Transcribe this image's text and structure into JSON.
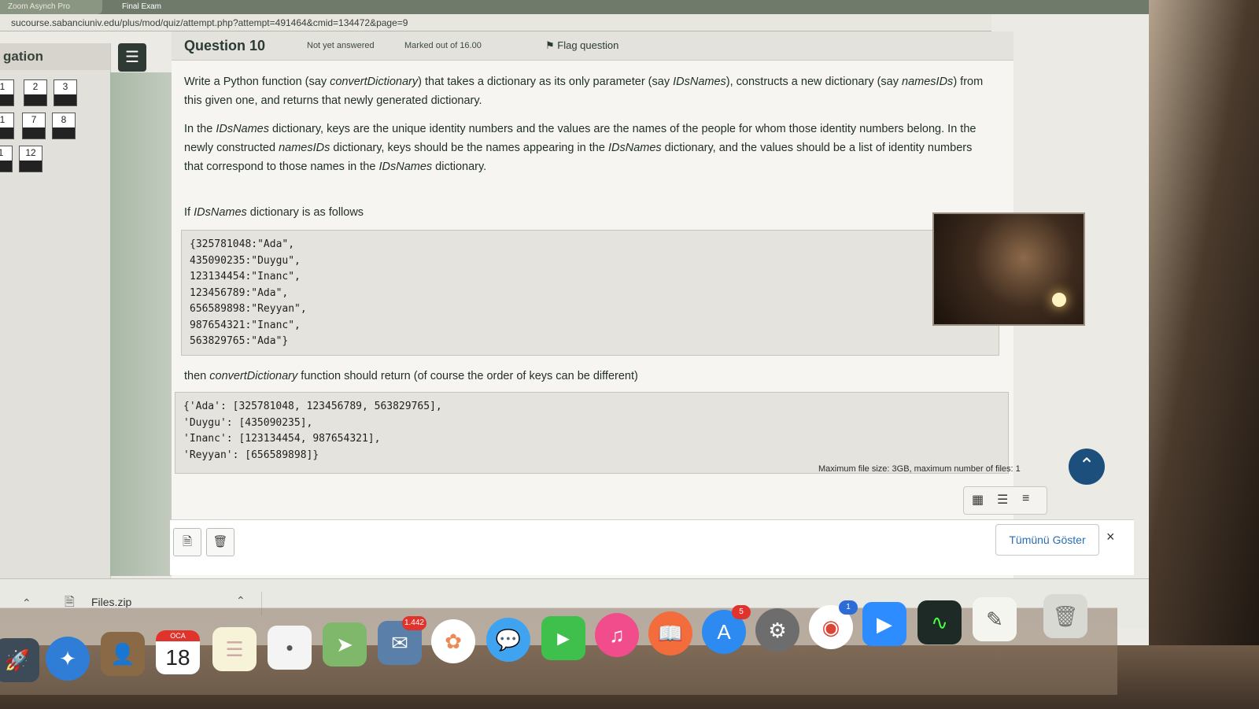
{
  "browser": {
    "tab_active": "Zoom Asynch Pro",
    "tab_second": "Final Exam",
    "url": "sucourse.sabanciuniv.edu/plus/mod/quiz/attempt.php?attempt=491464&cmid=134472&page=9"
  },
  "navigation": {
    "title": "gation",
    "boxes": [
      "1",
      "2",
      "3",
      "1",
      "7",
      "8",
      "1",
      "12"
    ]
  },
  "question": {
    "title": "Question 10",
    "state": "Not yet answered",
    "marked": "Marked out of 16.00",
    "flag": "Flag question",
    "para1_a": "Write a Python function (say ",
    "para1_fn": "convertDictionary",
    "para1_b": ") that takes a dictionary as its only parameter (say ",
    "para1_p": "IDsNames",
    "para1_c": "), constructs a new dictionary (say ",
    "para1_n": "namesIDs",
    "para1_d": ") from this given one, and returns that newly generated dictionary.",
    "para2_a": "In the ",
    "para2_i": "IDsNames",
    "para2_b": " dictionary, keys are the unique identity numbers and the values are the names of the people for whom those identity numbers belong. In the newly constructed ",
    "para2_n": "namesIDs",
    "para2_c": " dictionary, keys should be the names appearing in the ",
    "para2_i2": "IDsNames",
    "para2_d": " dictionary, and the values should be a list of identity numbers that correspond to those names in the ",
    "para2_i3": "IDsNames",
    "para2_e": " dictionary.",
    "para3_a": "If ",
    "para3_i": "IDsNames",
    "para3_b": " dictionary is as follows",
    "code1": [
      "{325781048:\"Ada\",",
      "435090235:\"Duygu\",",
      "123134454:\"Inanc\",",
      "123456789:\"Ada\",",
      "656589898:\"Reyyan\",",
      "987654321:\"Inanc\",",
      "563829765:\"Ada\"}"
    ],
    "para4_a": "then ",
    "para4_i": "convertDictionary",
    "para4_b": " function should return (of course the order of keys can be different)",
    "code2": [
      "{'Ada': [325781048, 123456789, 563829765],",
      "'Duygu': [435090235],",
      "'Inanc': [123134454, 987654321],",
      "'Reyyan': [656589898]}"
    ]
  },
  "upload": {
    "limits": "Maximum file size: 3GB, maximum number of files: 1"
  },
  "downloads": {
    "file_name": "Files.zip",
    "show_all": "Tümünü Göster",
    "close": "×"
  },
  "dock": {
    "calendar_month": "OCA",
    "calendar_day": "18",
    "badge_mail": "1.442",
    "badge_appstore": "5",
    "badge_chrome": "1"
  }
}
